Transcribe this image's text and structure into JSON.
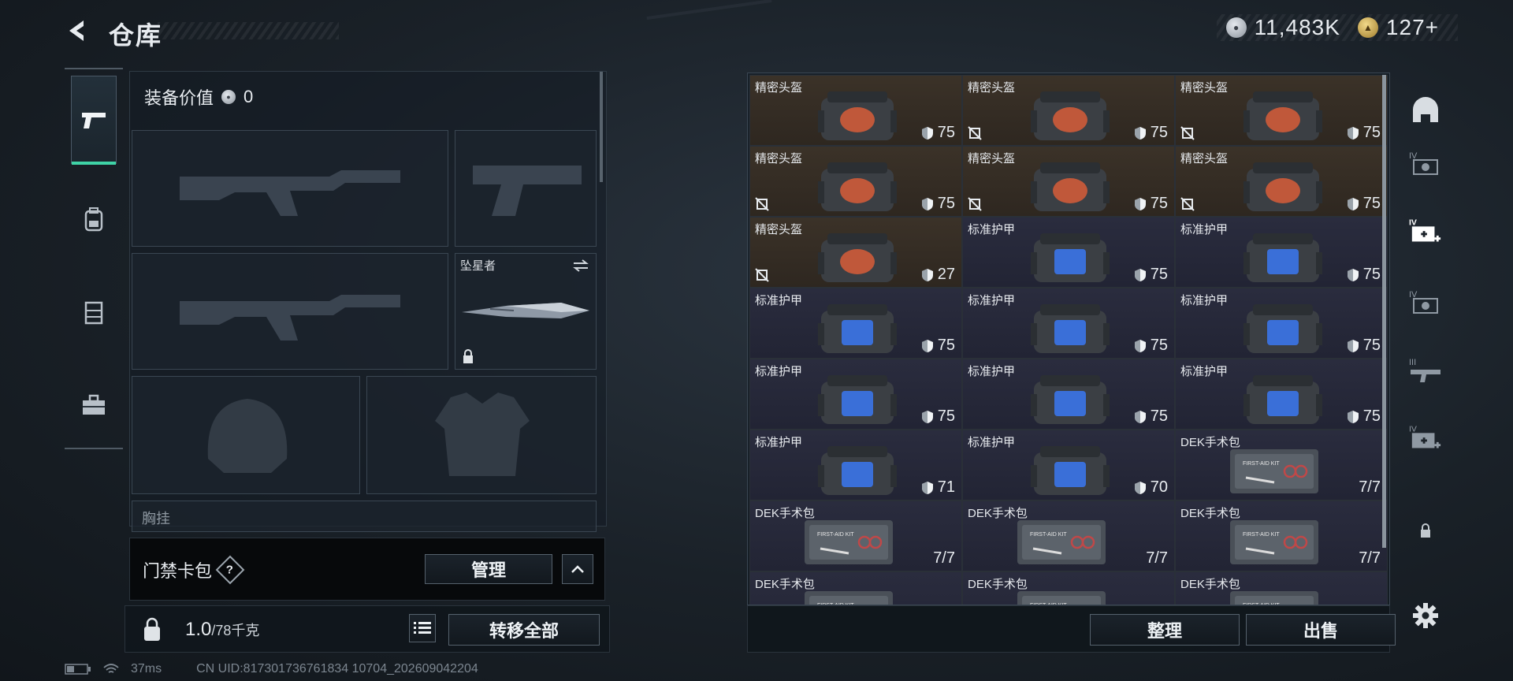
{
  "header": {
    "title": "仓库",
    "currency": [
      {
        "icon": "silver-coin-icon",
        "value": "11,483K"
      },
      {
        "icon": "gold-coin-icon",
        "value": "127+"
      }
    ]
  },
  "left_nav": [
    {
      "name": "weapon",
      "icon": "pistol-icon",
      "active": true
    },
    {
      "name": "backpack",
      "icon": "backpack-icon",
      "active": false
    },
    {
      "name": "chest-rig",
      "icon": "vest-icon",
      "active": false
    },
    {
      "name": "toolbox",
      "icon": "briefcase-icon",
      "active": false
    }
  ],
  "equipment": {
    "value_label": "装备价值",
    "value": "0",
    "melee_name": "坠星者",
    "partial_label": "胸挂"
  },
  "card_pack": {
    "label": "门禁卡包",
    "help": "?",
    "manage_label": "管理"
  },
  "bottom": {
    "weight": "1.0",
    "weight_cap": "/78千克",
    "transfer_all": "转移全部"
  },
  "grid_actions": {
    "sort_label": "整理",
    "sell_label": "出售"
  },
  "status": {
    "ping": "37ms",
    "uid": "CN UID:817301736761834 10704_202609042204"
  },
  "items": [
    {
      "name": "精密头盔",
      "type": "helmet",
      "value": "75",
      "unbind": false
    },
    {
      "name": "精密头盔",
      "type": "helmet",
      "value": "75",
      "unbind": true
    },
    {
      "name": "精密头盔",
      "type": "helmet",
      "value": "75",
      "unbind": true
    },
    {
      "name": "精密头盔",
      "type": "helmet",
      "value": "75",
      "unbind": true
    },
    {
      "name": "精密头盔",
      "type": "helmet",
      "value": "75",
      "unbind": true
    },
    {
      "name": "精密头盔",
      "type": "helmet",
      "value": "75",
      "unbind": true
    },
    {
      "name": "精密头盔",
      "type": "helmet",
      "value": "27",
      "unbind": true
    },
    {
      "name": "标准护甲",
      "type": "armor",
      "value": "75",
      "unbind": false
    },
    {
      "name": "标准护甲",
      "type": "armor",
      "value": "75",
      "unbind": false
    },
    {
      "name": "标准护甲",
      "type": "armor",
      "value": "75",
      "unbind": false
    },
    {
      "name": "标准护甲",
      "type": "armor",
      "value": "75",
      "unbind": false
    },
    {
      "name": "标准护甲",
      "type": "armor",
      "value": "75",
      "unbind": false
    },
    {
      "name": "标准护甲",
      "type": "armor",
      "value": "75",
      "unbind": false
    },
    {
      "name": "标准护甲",
      "type": "armor",
      "value": "75",
      "unbind": false
    },
    {
      "name": "标准护甲",
      "type": "armor",
      "value": "75",
      "unbind": false
    },
    {
      "name": "标准护甲",
      "type": "armor",
      "value": "71",
      "unbind": false
    },
    {
      "name": "标准护甲",
      "type": "armor",
      "value": "70",
      "unbind": false
    },
    {
      "name": "DEK手术包",
      "type": "medkit",
      "value": "7/7",
      "unbind": false
    },
    {
      "name": "DEK手术包",
      "type": "medkit",
      "value": "7/7",
      "unbind": false
    },
    {
      "name": "DEK手术包",
      "type": "medkit",
      "value": "7/7",
      "unbind": false
    },
    {
      "name": "DEK手术包",
      "type": "medkit",
      "value": "7/7",
      "unbind": false
    },
    {
      "name": "DEK手术包",
      "type": "medkit",
      "value": "",
      "unbind": false
    },
    {
      "name": "DEK手术包",
      "type": "medkit",
      "value": "",
      "unbind": false
    },
    {
      "name": "DEK手术包",
      "type": "medkit",
      "value": "",
      "unbind": false
    }
  ],
  "right_nav": [
    {
      "icon": "helmet-slot-icon"
    },
    {
      "icon": "iv-armor-icon"
    },
    {
      "icon": "iv-medkit-add-icon"
    },
    {
      "icon": "iv-armor-2-icon"
    },
    {
      "icon": "iii-rifle-icon"
    },
    {
      "icon": "iv-medkit-icon"
    },
    {
      "icon": "lock-icon"
    },
    {
      "icon": "gear-icon"
    }
  ]
}
